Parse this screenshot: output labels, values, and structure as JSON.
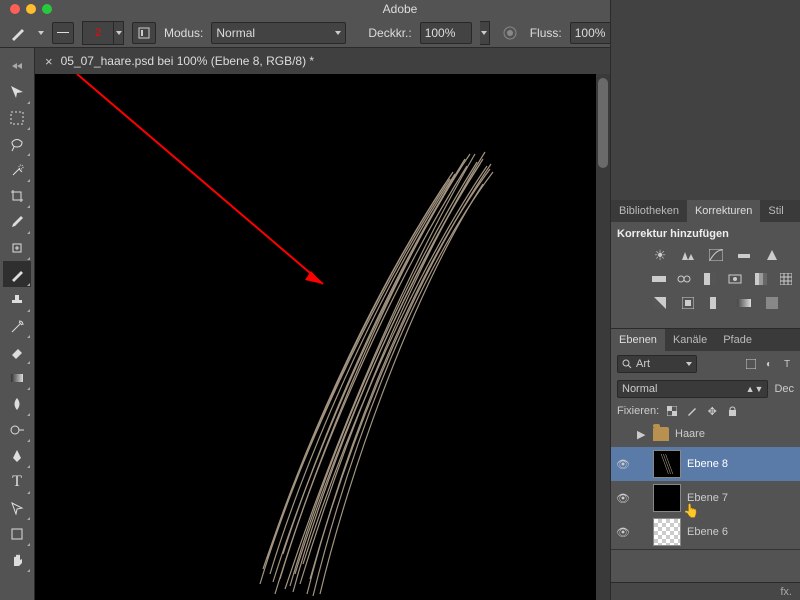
{
  "app": {
    "title": "Adobe"
  },
  "optbar": {
    "brush_size": "2",
    "mode_label": "Modus:",
    "mode_value": "Normal",
    "opacity_label": "Deckkr.:",
    "opacity_value": "100%",
    "flow_label": "Fluss:",
    "flow_value": "100%"
  },
  "document": {
    "name": "05_07_haare.psd bei 100% (Ebene 8, RGB/8) *",
    "close": "×"
  },
  "panels": {
    "tabs_top": [
      "Bibliotheken",
      "Korrekturen",
      "Stil"
    ],
    "adj_label": "Korrektur hinzufügen",
    "tabs_bottom": [
      "Ebenen",
      "Kanäle",
      "Pfade"
    ]
  },
  "layers": {
    "kind_value": "Art",
    "blend_value": "Normal",
    "opacity_label": "Dec",
    "lock_label": "Fixieren:",
    "items": [
      {
        "name": "Haare"
      },
      {
        "name": "Ebene 8"
      },
      {
        "name": "Ebene 7"
      },
      {
        "name": "Ebene 6"
      }
    ]
  },
  "bottom": {
    "fx": "fx."
  }
}
